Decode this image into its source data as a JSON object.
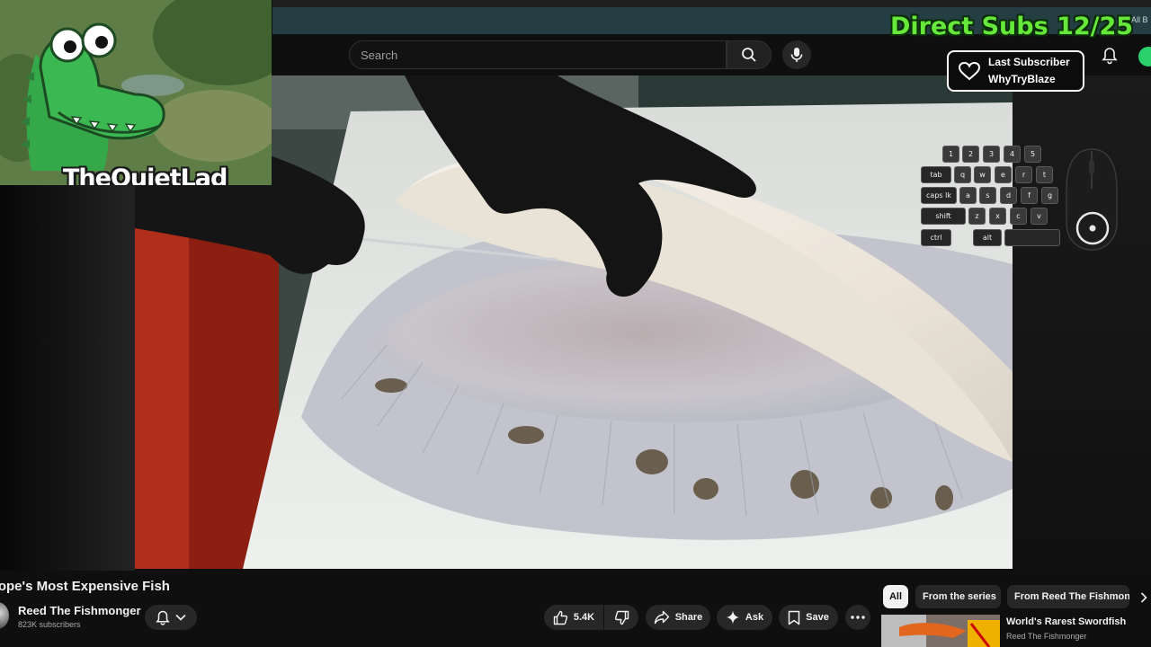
{
  "browser": {
    "bookmarks_label": "All B"
  },
  "header": {
    "search_placeholder": "Search"
  },
  "overlay": {
    "streamer_name": "TheQuietLad",
    "subs_goal": "Direct Subs 12/25",
    "last_subscriber_label": "Last Subscriber",
    "last_subscriber_name": "WhyTryBlaze",
    "keyboard_keys": [
      "1",
      "2",
      "3",
      "4",
      "5",
      "tab",
      "q",
      "w",
      "e",
      "r",
      "t",
      "caps lk",
      "a",
      "s",
      "d",
      "f",
      "g",
      "shift",
      "z",
      "x",
      "c",
      "v",
      "ctrl",
      "alt"
    ]
  },
  "video": {
    "title": "rope's Most Expensive Fish",
    "channel_name": "Reed The Fishmonger",
    "channel_subscribers": "823K subscribers",
    "like_count": "5.4K",
    "share_label": "Share",
    "ask_label": "Ask",
    "save_label": "Save"
  },
  "chips": [
    "All",
    "From the series",
    "From Reed The Fishmonger"
  ],
  "recommendation": {
    "title": "World's Rarest Swordfish",
    "channel": "Reed The Fishmonger"
  },
  "colors": {
    "subs_goal": "#66e83a",
    "accent_strip": "#243e44",
    "background": "#0f0f0f"
  }
}
